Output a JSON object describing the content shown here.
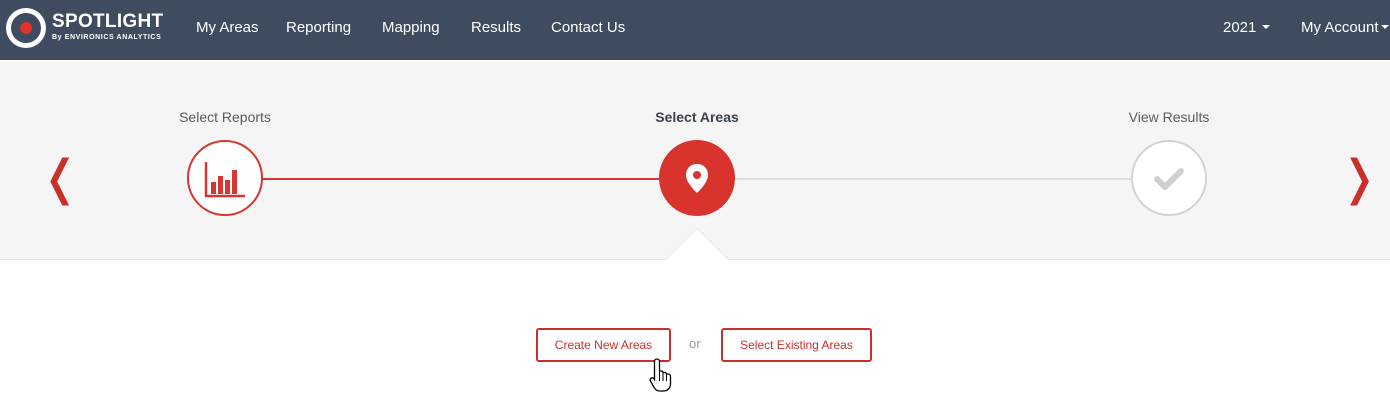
{
  "header": {
    "brand_title": "SPOTLIGHT",
    "brand_subtitle": "By ENVIRONICS ANALYTICS",
    "nav": [
      {
        "label": "My Areas"
      },
      {
        "label": "Reporting"
      },
      {
        "label": "Mapping"
      },
      {
        "label": "Results"
      },
      {
        "label": "Contact Us"
      }
    ],
    "year_label": "2021",
    "account_label": "My Account"
  },
  "steps": [
    {
      "label": "Select Reports",
      "state": "completed",
      "icon": "bar-chart-icon"
    },
    {
      "label": "Select Areas",
      "state": "active",
      "icon": "map-pin-icon"
    },
    {
      "label": "View Results",
      "state": "pending",
      "icon": "checkmark-icon"
    }
  ],
  "nav_arrows": {
    "prev": "❬",
    "next": "❭"
  },
  "actions": {
    "create_label": "Create New Areas",
    "or_label": "or",
    "select_label": "Select Existing Areas"
  },
  "colors": {
    "nav_bg": "#3f4b5e",
    "accent": "#d8332d",
    "panel_bg": "#f5f5f5",
    "pending": "#d2d2d2"
  }
}
